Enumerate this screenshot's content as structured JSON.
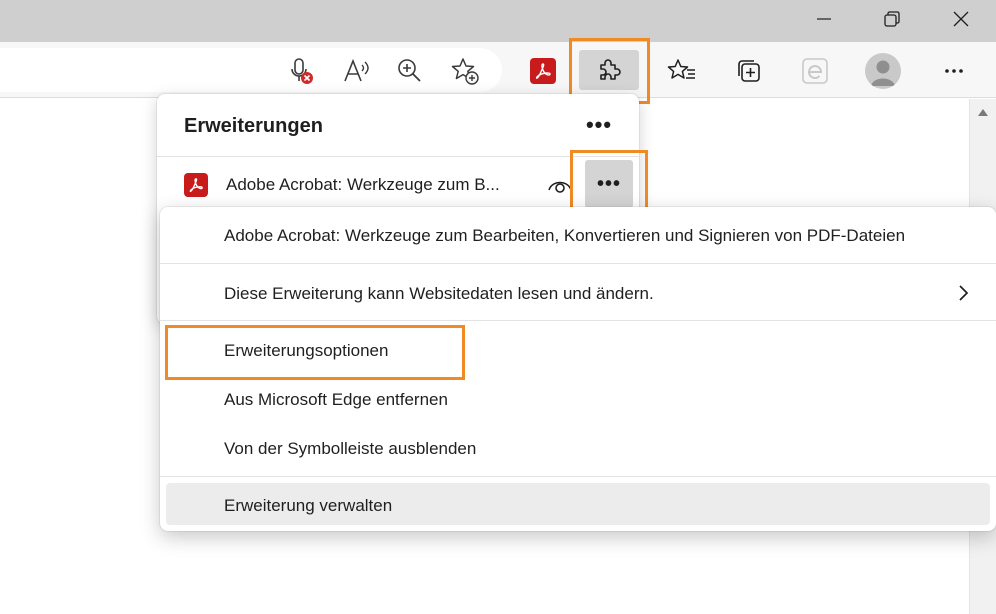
{
  "window_controls": {
    "minimize_icon": "minimize-icon",
    "restore_icon": "restore-icon",
    "close_icon": "close-icon"
  },
  "toolbar": {
    "icons": [
      "microphone-blocked-icon",
      "read-aloud-icon",
      "zoom-icon",
      "add-favorite-icon",
      "acrobat-extension-icon",
      "extensions-puzzle-icon",
      "favorites-icon",
      "collections-icon",
      "ie-mode-icon",
      "profile-avatar-icon",
      "more-options-icon"
    ]
  },
  "extensions_panel": {
    "title": "Erweiterungen",
    "more_label": "•••",
    "extension": {
      "name": "Adobe Acrobat: Werkzeuge zum B...",
      "more_label": "•••"
    }
  },
  "context_menu": {
    "description": "Adobe Acrobat: Werkzeuge zum Bearbeiten, Konvertieren und Signieren von PDF-Dateien",
    "site_access": "Diese Erweiterung kann Websitedaten lesen und ändern.",
    "options": "Erweiterungsoptionen",
    "remove": "Aus Microsoft Edge entfernen",
    "hide": "Von der Symbolleiste ausblenden",
    "manage": "Erweiterung verwalten"
  },
  "colors": {
    "highlight": "#f08a24",
    "acrobat_red": "#c81c1c",
    "titlebar": "#cfcfcf",
    "selected_button": "#d4d4d4"
  }
}
